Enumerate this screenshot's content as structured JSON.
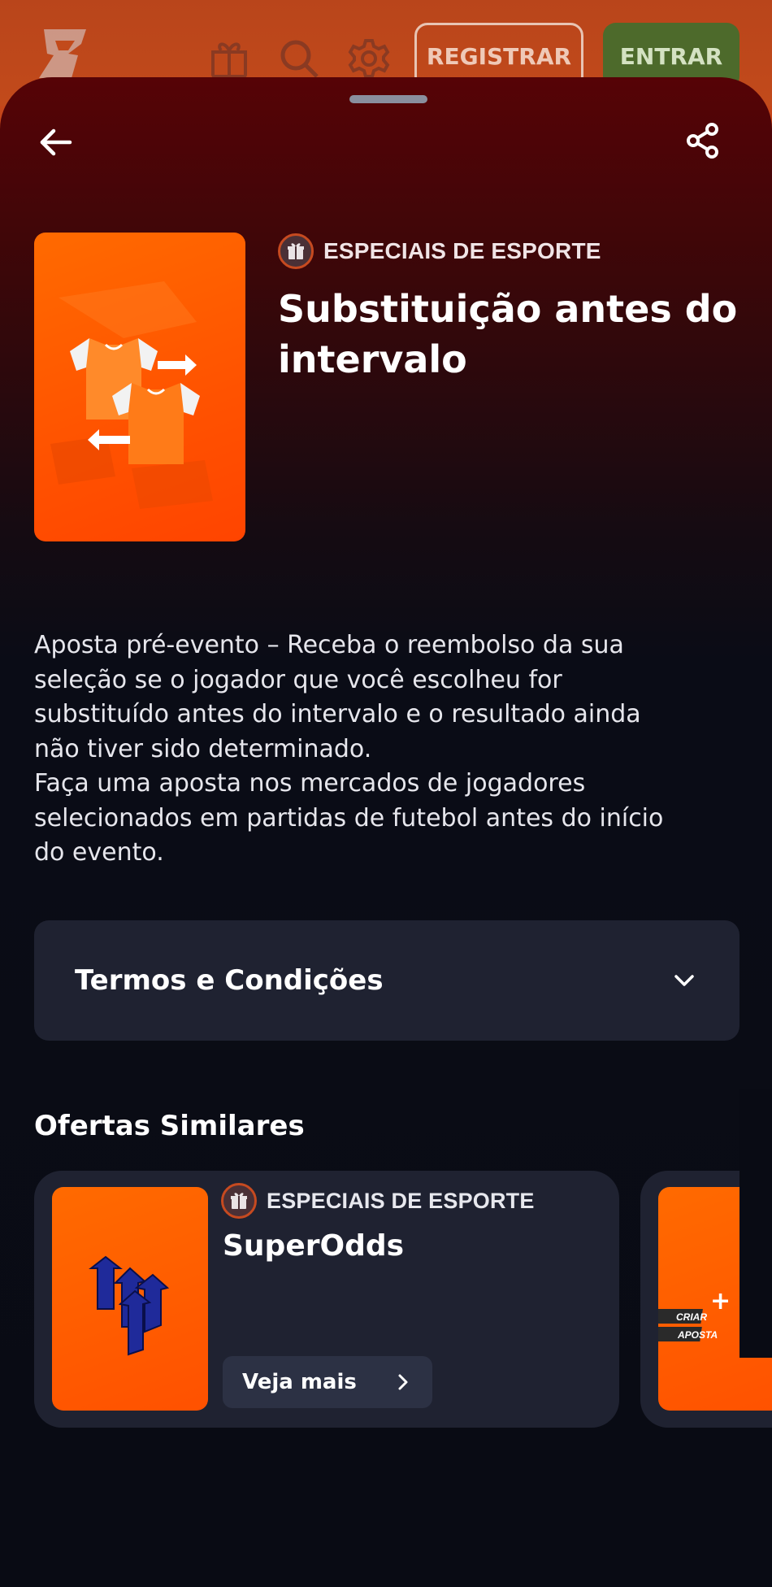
{
  "header": {
    "register_label": "REGISTRAR",
    "enter_label": "ENTRAR",
    "icons": [
      "logo-icon",
      "gift-icon",
      "search-icon",
      "gear-icon"
    ]
  },
  "promo": {
    "category": "ESPECIAIS DE ESPORTE",
    "title": "Substituição antes do intervalo",
    "description": "Aposta pré-evento – Receba o reembolso da sua\nseleção se o jogador que você escolheu for\nsubstituído antes do intervalo e o resultado ainda\nnão tiver sido determinado.\nFaça uma aposta nos mercados de jogadores\nselecionados em partidas de futebol antes do início\ndo evento."
  },
  "terms": {
    "label": "Termos e Condições"
  },
  "similar": {
    "title": "Ofertas Similares",
    "offers": [
      {
        "category": "ESPECIAIS DE ESPORTE",
        "title": "SuperOdds",
        "button_label": "Veja mais"
      },
      {
        "image_text_1": "CRIAR",
        "image_text_2": "APOSTA"
      }
    ]
  },
  "colors": {
    "brand_orange": "#ff5a00",
    "sheet_top": "#560306",
    "sheet_bottom": "#090b14",
    "card_bg": "#1f2231",
    "enter_green": "#4d6a2b"
  }
}
